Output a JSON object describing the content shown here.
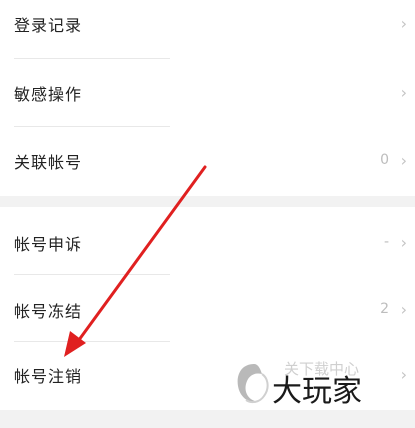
{
  "group1": {
    "items": [
      {
        "label": "登录记录",
        "value": "",
        "chevron": "›"
      },
      {
        "label": "敏感操作",
        "value": "",
        "chevron": "›"
      },
      {
        "label": "关联帐号",
        "value": "0",
        "chevron": "›"
      }
    ]
  },
  "group2": {
    "items": [
      {
        "label": "帐号申诉",
        "value": "-",
        "chevron": "›"
      },
      {
        "label": "帐号冻结",
        "value": "2",
        "chevron": "›"
      },
      {
        "label": "帐号注销",
        "value": "",
        "chevron": "›"
      }
    ]
  },
  "watermark": {
    "text": "大玩家",
    "ghost_text": "关下载中心"
  },
  "colors": {
    "arrow": "#e02020",
    "text": "#222222",
    "chevron": "#c4c4c4"
  }
}
